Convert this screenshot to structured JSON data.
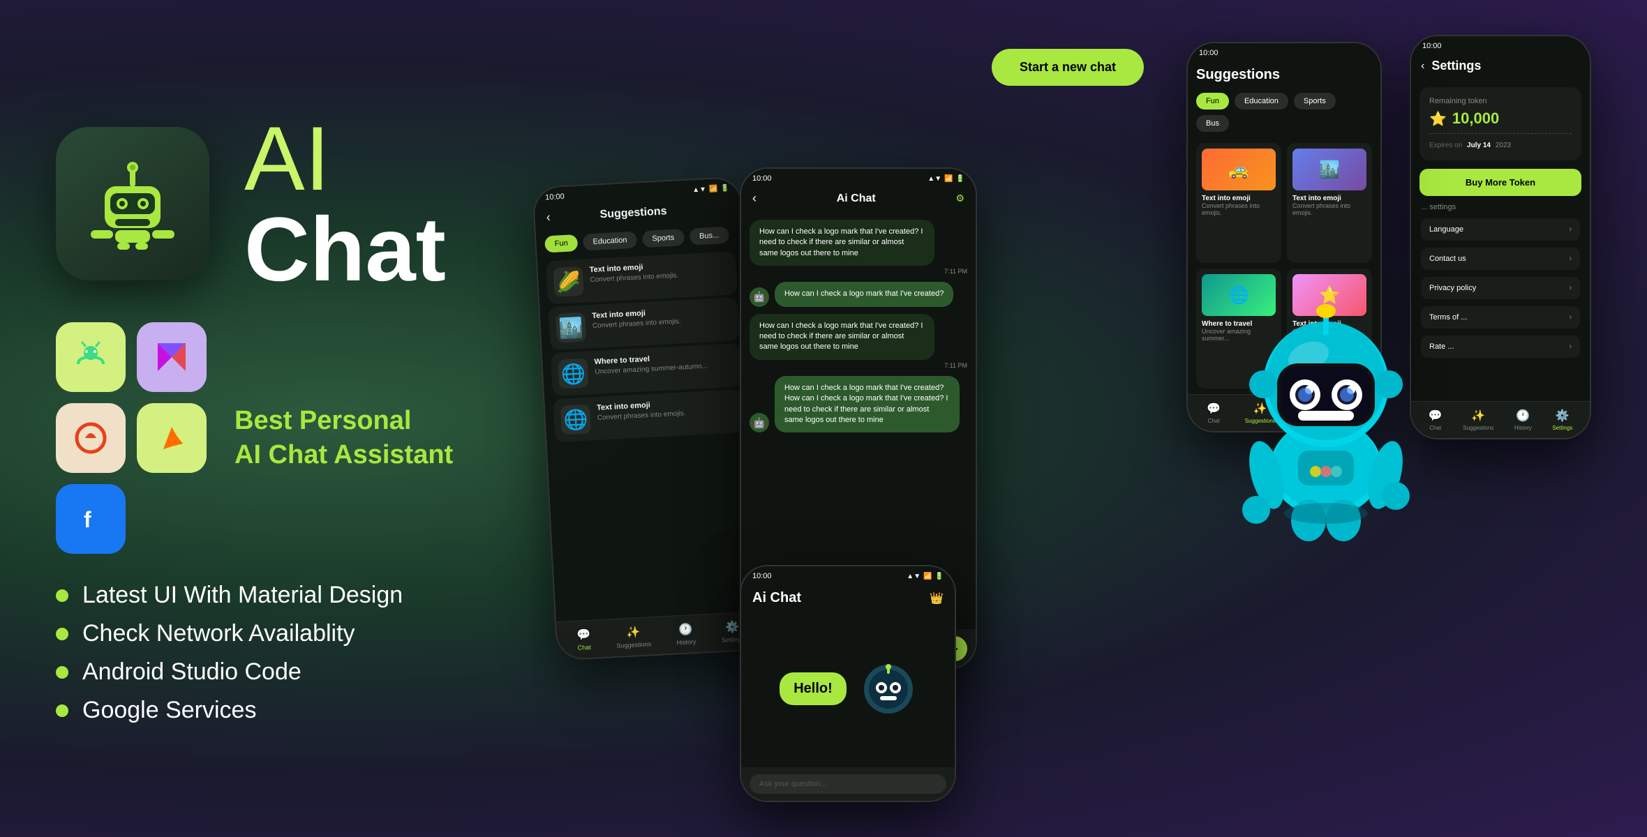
{
  "app": {
    "title_ai": "AI",
    "title_chat": "Chat",
    "tagline_line1": "Best Personal",
    "tagline_line2": "AI Chat Assistant",
    "icon_robot": "🤖"
  },
  "features": [
    {
      "text": "Latest UI With Material Design"
    },
    {
      "text": "Check Network Availablity"
    },
    {
      "text": "Android Studio Code"
    },
    {
      "text": "Google Services"
    }
  ],
  "tech_icons": [
    {
      "name": "android",
      "emoji": "🤖",
      "bg": "#d4f080"
    },
    {
      "name": "kotlin",
      "emoji": "K",
      "bg": "#c8b0f0"
    },
    {
      "name": "arc",
      "emoji": "⬤",
      "bg": "#f0e0c8"
    },
    {
      "name": "firebase",
      "emoji": "🔥",
      "bg": "#d4f080"
    },
    {
      "name": "facebook",
      "emoji": "f",
      "bg": "#1877f2"
    }
  ],
  "phones": {
    "main_chat": {
      "status_time": "10:00",
      "title": "Ai Chat",
      "messages": [
        {
          "type": "user",
          "text": "How can I check a logo mark that I've created? I need to check if there are similar or almost same logos out there to mine",
          "time": "7:11 PM"
        },
        {
          "type": "bot",
          "text": "How can I check a logo mark that I've created?"
        },
        {
          "type": "user",
          "text": "How can I check a logo mark that I've created? I need to check if there are similar or almost same logos out there to mine",
          "time": "7:11 PM"
        },
        {
          "type": "bot",
          "text": "How can I check a logo mark that I've created? How can I check a logo mark that I've created? I need to check if there are similar or almost same logos out there to mine"
        }
      ],
      "input_placeholder": "Ask your question..."
    },
    "suggestions": {
      "status_time": "10:00",
      "title": "Suggestions",
      "tabs": [
        "Fun",
        "Education",
        "Sports",
        "Bus"
      ],
      "active_tab": "Fun",
      "cards": [
        {
          "emoji": "🌽",
          "title": "Text into emoji",
          "desc": "Convert phrases into emojis."
        },
        {
          "emoji": "🏙️",
          "title": "Text into emoji",
          "desc": "Convert phrases into emojis."
        },
        {
          "emoji": "🌐",
          "title": "Where to travel",
          "desc": "Uncover amazing summer-autumn...",
          "globe": true
        },
        {
          "emoji": "🌐",
          "title": "Text into emoji",
          "desc": "Convert phrases into emojis."
        }
      ],
      "nav_items": [
        {
          "icon": "💬",
          "label": "Chat",
          "active": true
        },
        {
          "icon": "✨",
          "label": "Suggestions",
          "active": false
        },
        {
          "icon": "🕐",
          "label": "History",
          "active": false
        },
        {
          "icon": "⚙️",
          "label": "Settings",
          "active": false
        }
      ]
    },
    "settings": {
      "status_time": "10:00",
      "title": "Settings",
      "token_label": "Remaining token",
      "token_value": "10,000",
      "expires_label": "Expires on",
      "expires_date": "July 14",
      "expires_year": "2023",
      "buy_btn": "Buy More Token",
      "nav_items": [
        {
          "icon": "💬",
          "label": "Chat"
        },
        {
          "icon": "✨",
          "label": "Suggestions"
        },
        {
          "icon": "🕐",
          "label": "History"
        },
        {
          "icon": "⚙️",
          "label": "Settings"
        }
      ]
    },
    "start_chat": {
      "btn_label": "Start a new chat"
    },
    "lower_chat": {
      "status_time": "10:00",
      "title": "Ai Chat",
      "hello_text": "Hello!"
    }
  },
  "colors": {
    "accent": "#a8e840",
    "bg_dark": "#0f1410",
    "bg_card": "#1a1e1a",
    "text_primary": "#ffffff",
    "text_muted": "#888888"
  }
}
